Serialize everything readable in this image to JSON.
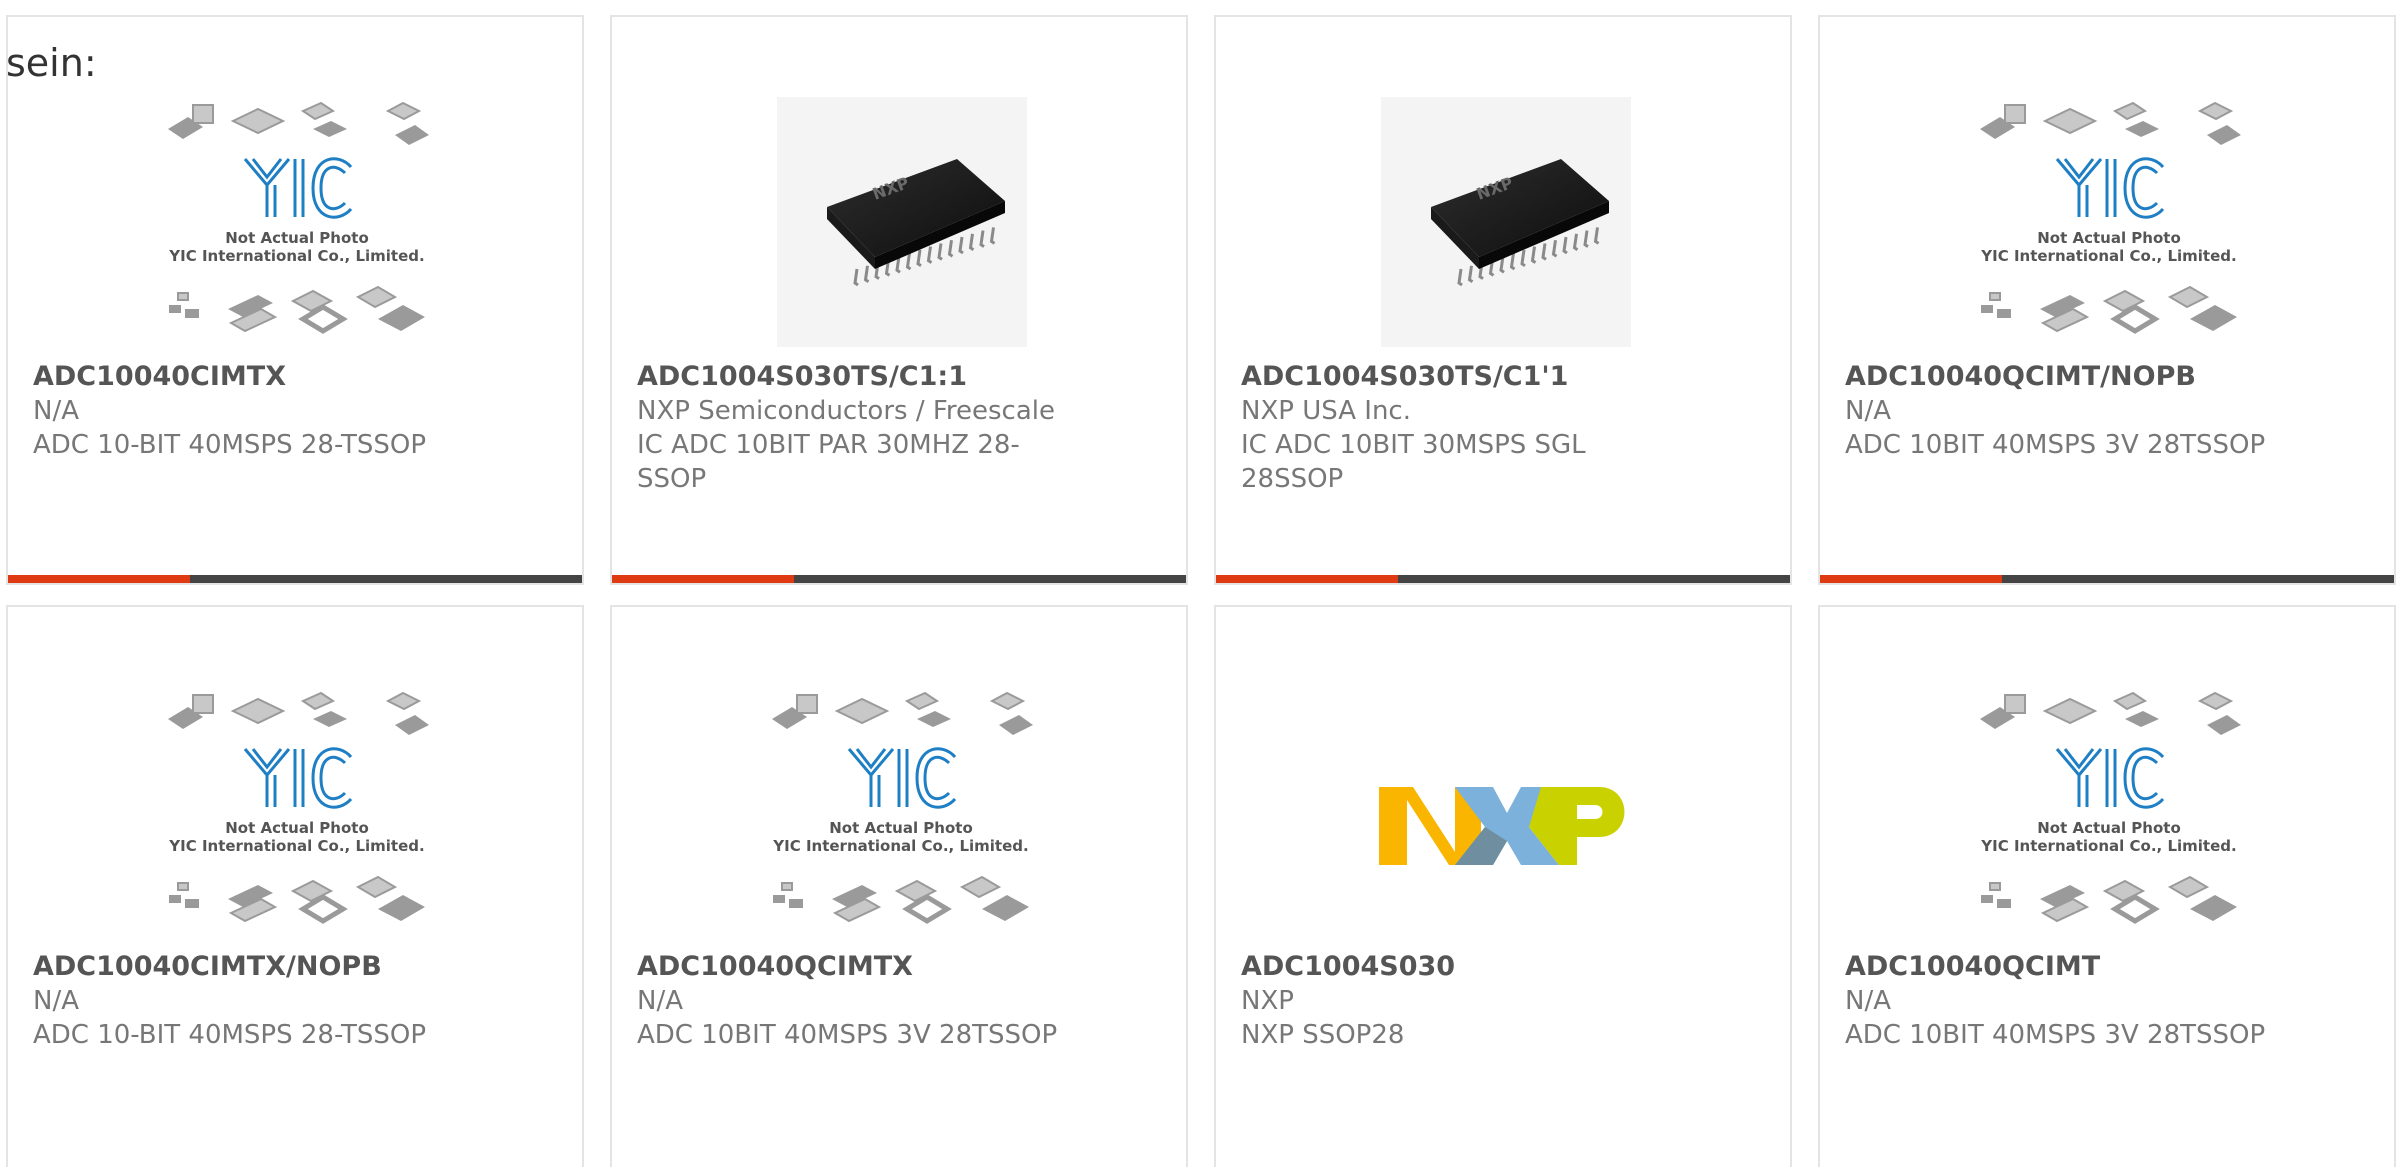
{
  "intro_text": "sein:",
  "colors": {
    "accent": "#e03a12",
    "bar": "#444444",
    "yic_blue": "#1f7fc4"
  },
  "placeholder": {
    "line1": "Not Actual Photo",
    "line2": "YIC International Co., Limited."
  },
  "products": [
    {
      "part": "ADC10040CIMTX",
      "manufacturer": "N/A",
      "description": "ADC 10-BIT 40MSPS 28-TSSOP",
      "image": "yic-placeholder"
    },
    {
      "part": "ADC1004S030TS/C1:1",
      "manufacturer": "NXP Semiconductors / Freescale",
      "description": "IC ADC 10BIT PAR 30MHZ 28-SSOP",
      "image": "ssop-chip"
    },
    {
      "part": "ADC1004S030TS/C1'1",
      "manufacturer": "NXP USA Inc.",
      "description": "IC ADC 10BIT 30MSPS SGL 28SSOP",
      "image": "ssop-chip"
    },
    {
      "part": "ADC10040QCIMT/NOPB",
      "manufacturer": "N/A",
      "description": "ADC 10BIT 40MSPS 3V 28TSSOP",
      "image": "yic-placeholder"
    },
    {
      "part": "ADC10040CIMTX/NOPB",
      "manufacturer": "N/A",
      "description": "ADC 10-BIT 40MSPS 28-TSSOP",
      "image": "yic-placeholder"
    },
    {
      "part": "ADC10040QCIMTX",
      "manufacturer": "N/A",
      "description": "ADC 10BIT 40MSPS 3V 28TSSOP",
      "image": "yic-placeholder"
    },
    {
      "part": "ADC1004S030",
      "manufacturer": "NXP",
      "description": "NXP SSOP28",
      "image": "nxp-logo"
    },
    {
      "part": "ADC10040QCIMT",
      "manufacturer": "N/A",
      "description": "ADC 10BIT 40MSPS 3V 28TSSOP",
      "image": "yic-placeholder"
    }
  ]
}
